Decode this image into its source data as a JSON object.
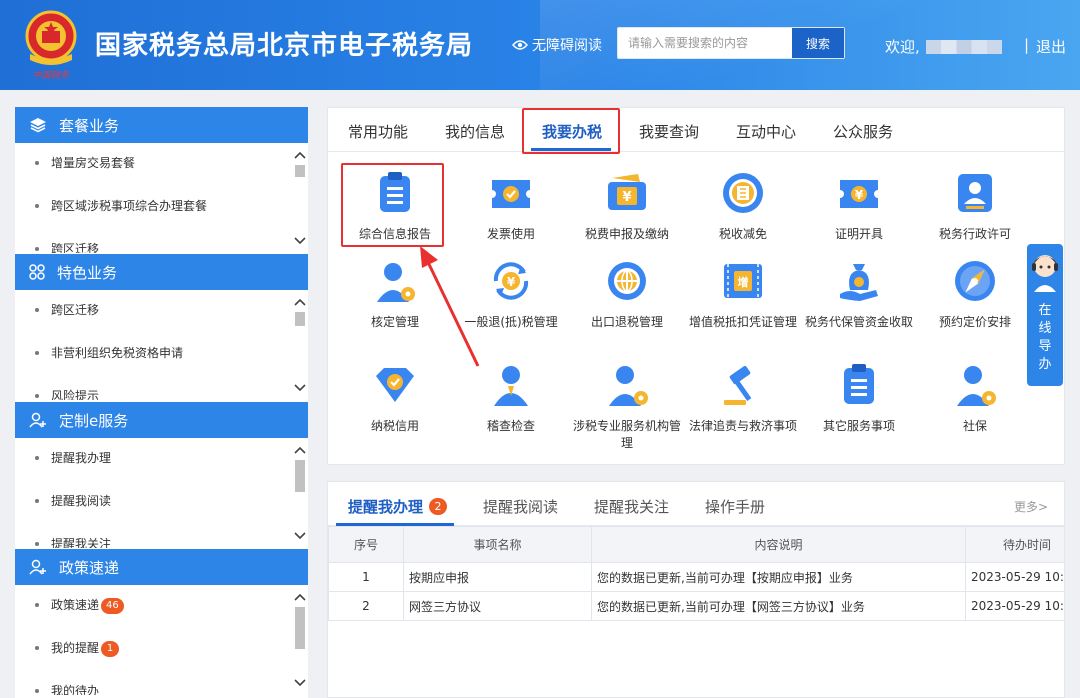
{
  "header": {
    "emblem_caption": "中国税务",
    "title": "国家税务总局北京市电子税务局",
    "accessibility_label": "无障碍阅读",
    "search_placeholder": "请输入需要搜索的内容",
    "search_button": "搜索",
    "welcome": "欢迎,",
    "divider": "|",
    "logout": "退出"
  },
  "sidebar": {
    "sections": [
      {
        "title": "套餐业务",
        "icon": "layers-icon",
        "items": [
          {
            "label": "增量房交易套餐"
          },
          {
            "label": "跨区域涉税事项综合办理套餐"
          },
          {
            "label": "跨区迁移"
          }
        ]
      },
      {
        "title": "特色业务",
        "icon": "grid-icon",
        "items": [
          {
            "label": "跨区迁移"
          },
          {
            "label": "非营利组织免税资格申请"
          },
          {
            "label": "风险提示"
          }
        ]
      },
      {
        "title": "定制e服务",
        "icon": "user-plus-icon",
        "items": [
          {
            "label": "提醒我办理"
          },
          {
            "label": "提醒我阅读"
          },
          {
            "label": "提醒我关注"
          }
        ]
      },
      {
        "title": "政策速递",
        "icon": "user-plus-icon",
        "items": [
          {
            "label": "政策速递",
            "badge": "46"
          },
          {
            "label": "我的提醒",
            "badge": "1"
          },
          {
            "label": "我的待办"
          }
        ]
      }
    ]
  },
  "main": {
    "tabs": [
      {
        "label": "常用功能"
      },
      {
        "label": "我的信息"
      },
      {
        "label": "我要办税",
        "active": true
      },
      {
        "label": "我要查询"
      },
      {
        "label": "互动中心"
      },
      {
        "label": "公众服务"
      }
    ],
    "functions": [
      {
        "label": "综合信息报告",
        "icon": "clipboard-icon"
      },
      {
        "label": "发票使用",
        "icon": "invoice-ticket-icon"
      },
      {
        "label": "税费申报及缴纳",
        "icon": "yuan-wallet-icon"
      },
      {
        "label": "税收减免",
        "icon": "tax-relief-icon"
      },
      {
        "label": "证明开具",
        "icon": "yuan-ticket-icon"
      },
      {
        "label": "税务行政许可",
        "icon": "id-badge-icon"
      },
      {
        "label": "核定管理",
        "icon": "user-gear-icon"
      },
      {
        "label": "一般退(抵)税管理",
        "icon": "yuan-refresh-icon"
      },
      {
        "label": "出口退税管理",
        "icon": "globe-icon"
      },
      {
        "label": "增值税抵扣凭证管理",
        "icon": "vat-voucher-icon"
      },
      {
        "label": "税务代保管资金收取",
        "icon": "money-bag-icon"
      },
      {
        "label": "预约定价安排",
        "icon": "compass-icon"
      },
      {
        "label": "纳税信用",
        "icon": "credit-shield-icon"
      },
      {
        "label": "稽查检查",
        "icon": "inspector-icon"
      },
      {
        "label": "涉税专业服务机构管理",
        "icon": "agent-gear-icon"
      },
      {
        "label": "法律追责与救济事项",
        "icon": "gavel-icon"
      },
      {
        "label": "其它服务事项",
        "icon": "list-doc-icon"
      },
      {
        "label": "社保",
        "icon": "social-security-icon"
      }
    ]
  },
  "bottom": {
    "tabs": [
      {
        "label": "提醒我办理",
        "badge": "2",
        "active": true
      },
      {
        "label": "提醒我阅读"
      },
      {
        "label": "提醒我关注"
      },
      {
        "label": "操作手册"
      }
    ],
    "more": "更多>",
    "table": {
      "headers": [
        "序号",
        "事项名称",
        "内容说明",
        "待办时间"
      ],
      "rows": [
        [
          "1",
          "按期应申报",
          "您的数据已更新,当前可办理【按期应申报】业务",
          "2023-05-29 10:"
        ],
        [
          "2",
          "网签三方协议",
          "您的数据已更新,当前可办理【网签三方协议】业务",
          "2023-05-29 10:"
        ]
      ]
    }
  },
  "float_help": {
    "label_chars": [
      "在",
      "线",
      "导",
      "办"
    ]
  },
  "colors": {
    "header_blue": "#2a84e8",
    "sidebar_blue": "#2d85e8",
    "active_blue": "#1f5fc4",
    "highlight_red": "#e83030",
    "badge_orange": "#ee5a24"
  }
}
